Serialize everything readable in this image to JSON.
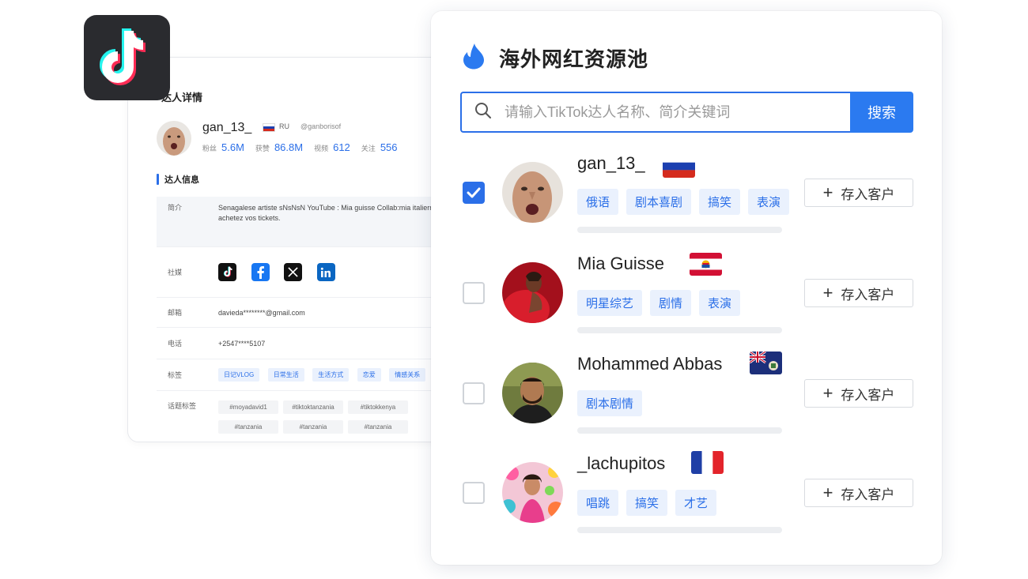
{
  "detail": {
    "title": "达人详情",
    "name": "gan_13_",
    "country": "RU",
    "handle": "@ganborisof",
    "stats": [
      {
        "label": "粉丝",
        "value": "5.6M"
      },
      {
        "label": "获赞",
        "value": "86.8M"
      },
      {
        "label": "视频",
        "value": "612"
      },
      {
        "label": "关注",
        "value": "556"
      }
    ],
    "section_title": "达人信息",
    "bio_label": "简介",
    "bio": "Senagalese artiste sNsNsN YouTube : Mia guisse Collab:mia italierr milano achetez vos tickets.",
    "social_label": "社媒",
    "email_label": "邮箱",
    "email": "davieda********@gmail.com",
    "phone_label": "电话",
    "phone": "+2547****5107",
    "tags_label": "标签",
    "tags": [
      "日记VLOG",
      "日常生活",
      "生活方式",
      "恋爱",
      "情感关系"
    ],
    "topics_label": "话题标签",
    "topics": [
      "#moyadavid1",
      "#tiktoktanzania",
      "#tiktokkenya",
      "#tanzania",
      "#tanzania",
      "#tanzania"
    ]
  },
  "pool": {
    "title": "海外网红资源池",
    "search_placeholder": "请输入TikTok达人名称、简介关键词",
    "search_button": "搜索",
    "save_label": "存入客户",
    "results": [
      {
        "name": "gan_13_",
        "flag": "ru",
        "checked": true,
        "tags": [
          "俄语",
          "剧本喜剧",
          "搞笑",
          "表演"
        ]
      },
      {
        "name": "Mia Guisse",
        "flag": "pf",
        "checked": false,
        "tags": [
          "明星综艺",
          "剧情",
          "表演"
        ]
      },
      {
        "name": "Mohammed Abbas",
        "flag": "gs",
        "checked": false,
        "tags": [
          "剧本剧情"
        ]
      },
      {
        "name": "_lachupitos",
        "flag": "fr",
        "checked": false,
        "tags": [
          "唱跳",
          "搞笑",
          "才艺"
        ]
      }
    ]
  },
  "colors": {
    "accent": "#2b6fe8",
    "tag_bg": "#eaf1fd"
  }
}
